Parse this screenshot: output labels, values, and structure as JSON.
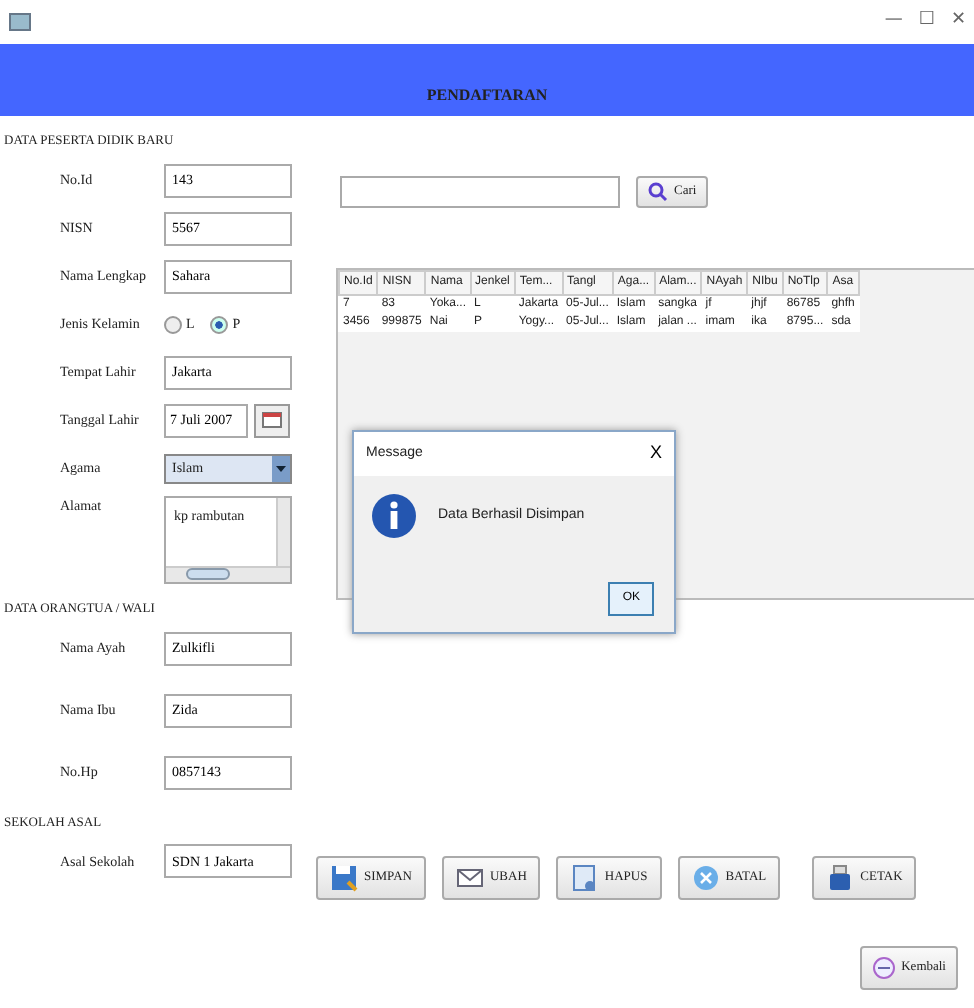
{
  "window": {
    "controls": [
      "—",
      "☐",
      "✕"
    ]
  },
  "header": {
    "title": "PENDAFTARAN"
  },
  "sections": [
    {
      "heading": "DATA PESERTA DIDIK BARU",
      "fields": [
        {
          "kind": "text",
          "label": "No.Id",
          "value": "143"
        },
        {
          "kind": "text",
          "label": "NISN",
          "value": "5567"
        },
        {
          "kind": "text",
          "label": "Nama Lengkap",
          "value": "Sahara"
        },
        {
          "kind": "radio",
          "label": "Jenis Kelamin",
          "options": [
            {
              "label": "L",
              "selected": false
            },
            {
              "label": "P",
              "selected": true
            }
          ]
        },
        {
          "kind": "text",
          "label": "Tempat Lahir",
          "value": "Jakarta"
        },
        {
          "kind": "date",
          "label": "Tanggal Lahir",
          "value": "7 Juli 2007"
        },
        {
          "kind": "select",
          "label": "Agama",
          "value": "Islam"
        },
        {
          "kind": "textarea",
          "label": "Alamat",
          "value": "kp rambutan"
        }
      ]
    },
    {
      "heading": "DATA ORANGTUA / WALI",
      "fields": [
        {
          "kind": "text",
          "label": "Nama Ayah",
          "value": "Zulkifli"
        },
        {
          "kind": "text",
          "label": "Nama Ibu",
          "value": "Zida"
        },
        {
          "kind": "text",
          "label": "No.Hp",
          "value": "0857143"
        }
      ]
    },
    {
      "heading": "SEKOLAH ASAL",
      "fields": [
        {
          "kind": "text",
          "label": "Asal Sekolah",
          "value": "SDN 1 Jakarta"
        }
      ]
    }
  ],
  "search": {
    "button": "Cari"
  },
  "table": {
    "columns": [
      "No.Id",
      "NISN",
      "Nama",
      "Jenkel",
      "Tem...",
      "Tangl",
      "Aga...",
      "Alam...",
      "NAyah",
      "NIbu",
      "NoTlp",
      "Asa"
    ],
    "rows": [
      [
        "7",
        "83",
        "Yoka...",
        "L",
        "Jakarta",
        "05-Jul...",
        "Islam",
        "sangka",
        "jf",
        "jhjf",
        "86785",
        "ghfh"
      ],
      [
        "3456",
        "999875",
        "Nai",
        "P",
        "Yogy...",
        "05-Jul...",
        "Islam",
        "jalan ...",
        "imam",
        "ika",
        "8795...",
        "sda"
      ]
    ]
  },
  "actions": [
    {
      "kind": "save",
      "label": "SIMPAN"
    },
    {
      "kind": "edit",
      "label": "UBAH"
    },
    {
      "kind": "delete",
      "label": "HAPUS"
    },
    {
      "kind": "cancel",
      "label": "BATAL"
    },
    {
      "kind": "print",
      "label": "CETAK"
    }
  ],
  "back_button": {
    "label": "Kembali"
  },
  "dialog": {
    "title": "Message",
    "close": "X",
    "message": "Data Berhasil Disimpan",
    "button": "OK"
  }
}
